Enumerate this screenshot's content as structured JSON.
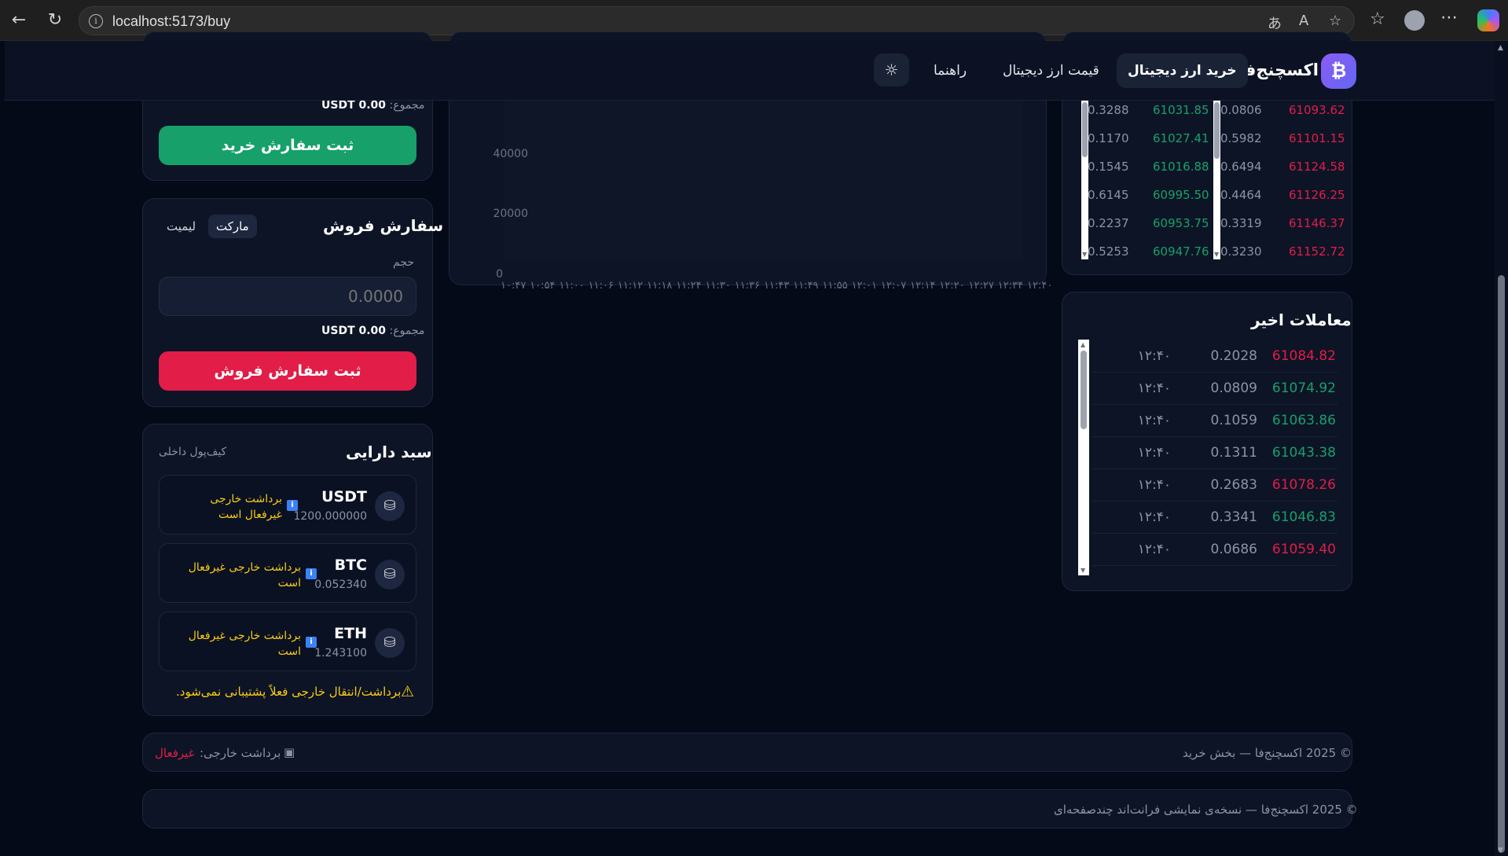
{
  "browser": {
    "url": "localhost:5173/buy"
  },
  "header": {
    "logo_glyph": "₿",
    "brand": "اکسچنج‌فا",
    "nav": [
      {
        "label": "خرید ارز دیجیتال",
        "active": true
      },
      {
        "label": "قیمت ارز دیجیتال",
        "active": false
      },
      {
        "label": "راهنما",
        "active": false
      }
    ],
    "theme_icon": "sun-icon"
  },
  "buy_order": {
    "total_label": "مجموع:",
    "total_value": "USDT 0.00",
    "submit_label": "ثبت سفارش خرید"
  },
  "sell_order": {
    "title": "سفارش فروش",
    "tabs": [
      "مارکت",
      "لیمیت"
    ],
    "active_tab": "مارکت",
    "volume_label": "حجم",
    "volume_placeholder": "0.0000",
    "total_label": "مجموع:",
    "total_value": "USDT 0.00",
    "submit_label": "ثبت سفارش فروش"
  },
  "wallet": {
    "title": "سبد دارایی",
    "subtitle": "کیف‌پول داخلی",
    "assets": [
      {
        "symbol": "USDT",
        "amount": "1200.000000",
        "warning_line1": "برداشت خارجی",
        "warning_line2": "غیرفعال است"
      },
      {
        "symbol": "BTC",
        "amount": "0.052340",
        "warning_line1": "برداشت خارجی غیرفعال",
        "warning_line2": "است"
      },
      {
        "symbol": "ETH",
        "amount": "1.243100",
        "warning_line1": "برداشت خارجی غیرفعال",
        "warning_line2": "است"
      }
    ],
    "note": "برداشت/انتقال خارجی فعلاً پشتیبانی نمی‌شود."
  },
  "chart": {
    "y_ticks": [
      "40000",
      "20000",
      "0"
    ],
    "x_ticks": [
      "۱۰:۴۷",
      "۱۰:۵۴",
      "۱۱:۰۰",
      "۱۱:۰۶",
      "۱۱:۱۲",
      "۱۱:۱۸",
      "۱۱:۲۴",
      "۱۱:۳۰",
      "۱۱:۳۶",
      "۱۱:۴۳",
      "۱۱:۴۹",
      "۱۱:۵۵",
      "۱۲:۰۱",
      "۱۲:۰۷",
      "۱۲:۱۴",
      "۱۲:۲۰",
      "۱۲:۲۷",
      "۱۲:۳۴",
      "۱۲:۴۰"
    ]
  },
  "order_book": {
    "bids": [
      {
        "amount": "0.3288",
        "price": "61031.85"
      },
      {
        "amount": "0.1170",
        "price": "61027.41"
      },
      {
        "amount": "0.1545",
        "price": "61016.88"
      },
      {
        "amount": "0.6145",
        "price": "60995.50"
      },
      {
        "amount": "0.2237",
        "price": "60953.75"
      },
      {
        "amount": "0.5253",
        "price": "60947.76"
      }
    ],
    "asks": [
      {
        "amount": "0.0806",
        "price": "61093.62"
      },
      {
        "amount": "0.5982",
        "price": "61101.15"
      },
      {
        "amount": "0.6494",
        "price": "61124.58"
      },
      {
        "amount": "0.4464",
        "price": "61126.25"
      },
      {
        "amount": "0.3319",
        "price": "61146.37"
      },
      {
        "amount": "0.3230",
        "price": "61152.72"
      }
    ]
  },
  "recent_trades": {
    "title": "معاملات اخیر",
    "rows": [
      {
        "price": "61084.82",
        "side": "sell",
        "amount": "0.2028",
        "time": "۱۲:۴۰"
      },
      {
        "price": "61074.92",
        "side": "buy",
        "amount": "0.0809",
        "time": "۱۲:۴۰"
      },
      {
        "price": "61063.86",
        "side": "buy",
        "amount": "0.1059",
        "time": "۱۲:۴۰"
      },
      {
        "price": "61043.38",
        "side": "buy",
        "amount": "0.1311",
        "time": "۱۲:۴۰"
      },
      {
        "price": "61078.26",
        "side": "sell",
        "amount": "0.2683",
        "time": "۱۲:۴۰"
      },
      {
        "price": "61046.83",
        "side": "buy",
        "amount": "0.3341",
        "time": "۱۲:۴۰"
      },
      {
        "price": "61059.40",
        "side": "sell",
        "amount": "0.0686",
        "time": "۱۲:۴۰"
      }
    ]
  },
  "status_bar": {
    "copyright": "© 2025 اکسچنج‌فا — بخش خرید",
    "withdraw_label": "برداشت خارجی:",
    "withdraw_status": "غیرفعال"
  },
  "footer": {
    "text": "© 2025 اکسچنج‌فا — نسخه‌ی نمایشی فرانت‌اند چندصفحه‌ای"
  },
  "colors": {
    "buy": "#17a06a",
    "sell": "#e11d48",
    "background": "#050a18",
    "card": "#0d1426",
    "warning": "#facc15",
    "brand": "#8b5cf6"
  }
}
